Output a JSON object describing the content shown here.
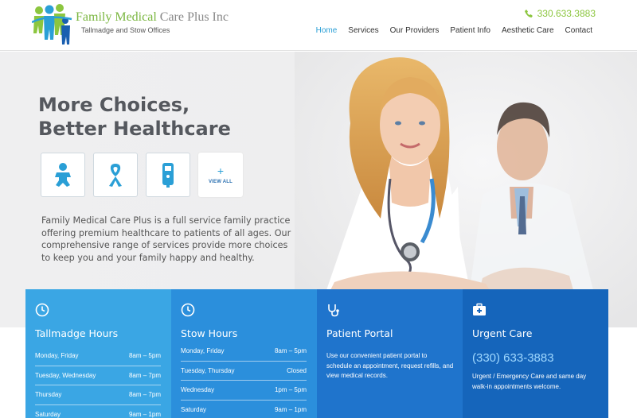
{
  "brand": {
    "name_part1": "Family Medical",
    "name_part2": "Care Plus Inc",
    "tagline": "Tallmadge and Stow Offices",
    "colors": {
      "green": "#8cc63f",
      "blue": "#2a9fd6"
    }
  },
  "header": {
    "phone": "330.633.3883",
    "nav": [
      {
        "label": "Home",
        "active": true
      },
      {
        "label": "Services",
        "active": false
      },
      {
        "label": "Our Providers",
        "active": false
      },
      {
        "label": "Patient Info",
        "active": false
      },
      {
        "label": "Aesthetic Care",
        "active": false
      },
      {
        "label": "Contact",
        "active": false
      }
    ]
  },
  "hero": {
    "headline_line1": "More Choices,",
    "headline_line2": "Better Healthcare",
    "services": [
      {
        "icon": "baby-icon"
      },
      {
        "icon": "awareness-ribbon-icon"
      },
      {
        "icon": "glucose-meter-icon"
      },
      {
        "icon": "plus-icon",
        "label": "VIEW ALL"
      }
    ],
    "intro": "Family Medical Care Plus is a full service family practice offering premium  healthcare to patients of all ages. Our comprehensive range of services  provide more choices to keep you  and your family happy and healthy."
  },
  "boxes": {
    "tallmadge": {
      "icon": "clock-icon",
      "title": "Tallmadge Hours",
      "rows": [
        {
          "day": "Monday, Friday",
          "time": "8am – 5pm"
        },
        {
          "day": "Tuesday, Wednesday",
          "time": "8am – 7pm"
        },
        {
          "day": "Thursday",
          "time": "8am – 7pm"
        },
        {
          "day": "Saturday",
          "time": "9am – 1pm"
        }
      ]
    },
    "stow": {
      "icon": "clock-icon",
      "title": "Stow Hours",
      "rows": [
        {
          "day": "Monday, Friday",
          "time": "8am – 5pm"
        },
        {
          "day": "Tuesday, Thursday",
          "time": "Closed"
        },
        {
          "day": "Wednesday",
          "time": "1pm – 5pm"
        },
        {
          "day": "Saturday",
          "time": "9am – 1pm"
        }
      ]
    },
    "portal": {
      "icon": "stethoscope-icon",
      "title": "Patient Portal",
      "text": "Use our convenient patient portal to schedule an appointment, request refills, and view medical records."
    },
    "urgent": {
      "icon": "medical-kit-icon",
      "title": "Urgent Care",
      "phone": "(330) 633-3883",
      "text": "Urgent / Emergency Care and same day walk-in appointments welcome."
    }
  }
}
